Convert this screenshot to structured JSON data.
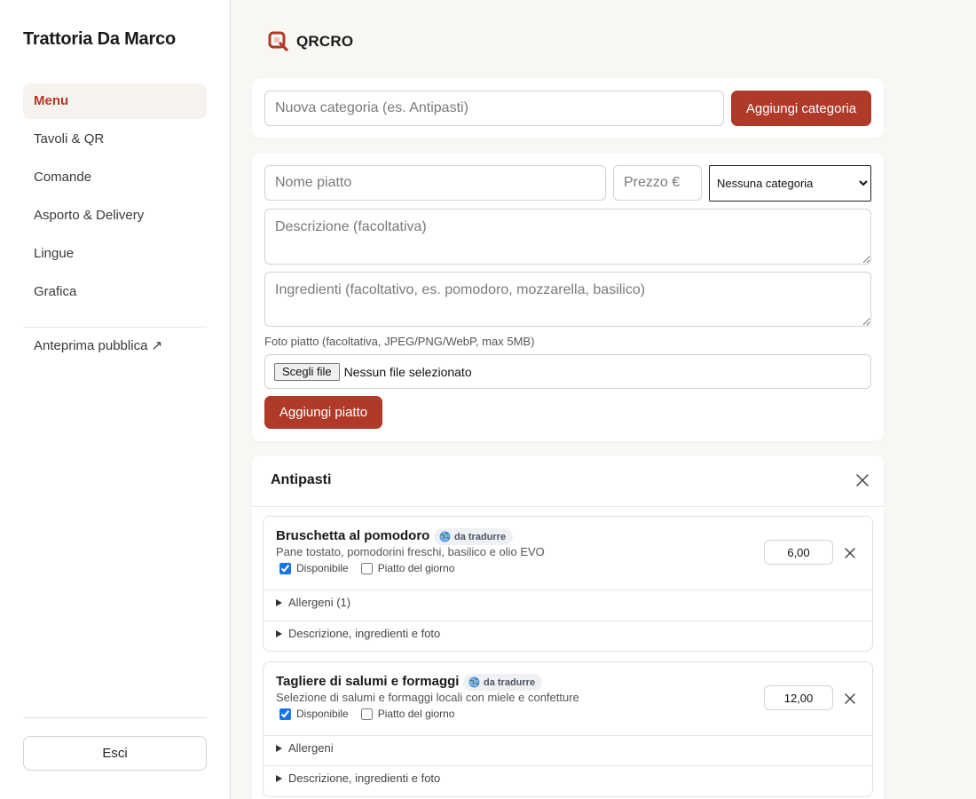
{
  "sidebar": {
    "restaurant_name": "Trattoria Da Marco",
    "items": [
      {
        "label": "Menu",
        "active": true
      },
      {
        "label": "Tavoli & QR",
        "active": false
      },
      {
        "label": "Comande",
        "active": false
      },
      {
        "label": "Asporto & Delivery",
        "active": false
      },
      {
        "label": "Lingue",
        "active": false
      },
      {
        "label": "Grafica",
        "active": false
      }
    ],
    "public_preview": "Anteprima pubblica ↗",
    "logout_label": "Esci"
  },
  "header": {
    "brand": "QRCRO",
    "logo_icon": "q-magnifier-logo-icon"
  },
  "category_form": {
    "placeholder": "Nuova categoria (es. Antipasti)",
    "value": "",
    "add_label": "Aggiungi categoria"
  },
  "dish_form": {
    "name_placeholder": "Nome piatto",
    "price_placeholder": "Prezzo €",
    "category_selected": "Nessuna categoria",
    "description_placeholder": "Descrizione (facoltativa)",
    "ingredients_placeholder": "Ingredienti (facoltativo, es. pomodoro, mozzarella, basilico)",
    "photo_hint": "Foto piatto (facoltativa, JPEG/PNG/WebP, max 5MB)",
    "file_button": "Scegli file",
    "file_status": "Nessun file selezionato",
    "add_label": "Aggiungi piatto"
  },
  "section": {
    "title": "Antipasti",
    "items": [
      {
        "name": "Bruschetta al pomodoro",
        "badge": "da tradurre",
        "description": "Pane tostato, pomodorini freschi, basilico e olio EVO",
        "available_label": "Disponibile",
        "available": true,
        "dish_of_day_label": "Piatto del giorno",
        "dish_of_day": false,
        "price": "6,00",
        "allergens_label": "Allergeni (1)",
        "details_label": "Descrizione, ingredienti e foto"
      },
      {
        "name": "Tagliere di salumi e formaggi",
        "badge": "da tradurre",
        "description": "Selezione di salumi e formaggi locali con miele e confetture",
        "available_label": "Disponibile",
        "available": true,
        "dish_of_day_label": "Piatto del giorno",
        "dish_of_day": false,
        "price": "12,00",
        "allergens_label": "Allergeni",
        "details_label": "Descrizione, ingredienti e foto"
      }
    ]
  },
  "colors": {
    "accent": "#b03a2a",
    "background": "#f9f7f4",
    "active_nav_bg": "#f6f2ed"
  }
}
